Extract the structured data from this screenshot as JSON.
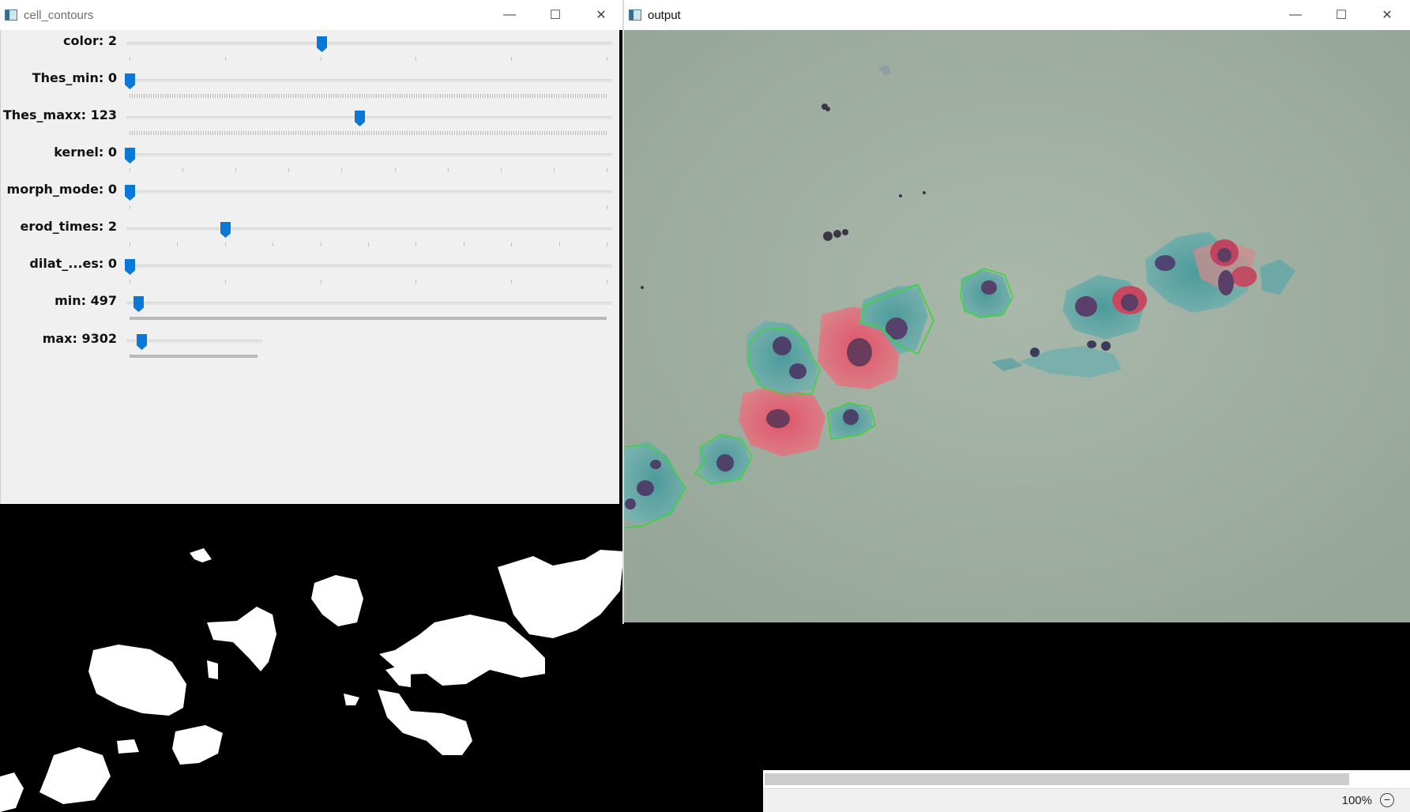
{
  "left_window": {
    "title": "cell_contours",
    "controls": {
      "minimize": "—",
      "maximize": "☐",
      "close": "✕"
    },
    "trackbars": [
      {
        "label": "color: 2",
        "fraction": 0.402,
        "ticks": "sparse"
      },
      {
        "label": "Thes_min: 0",
        "fraction": 0.0,
        "ticks": "dense"
      },
      {
        "label": "Thes_maxx: 123",
        "fraction": 0.482,
        "ticks": "dense"
      },
      {
        "label": "kernel: 0",
        "fraction": 0.0,
        "ticks": "sparse"
      },
      {
        "label": "morph_mode: 0",
        "fraction": 0.0,
        "ticks": "ends"
      },
      {
        "label": "erod_times: 2",
        "fraction": 0.2,
        "ticks": "sparse"
      },
      {
        "label": "dilat_...es: 0",
        "fraction": 0.0,
        "ticks": "sparse"
      },
      {
        "label": "min: 497",
        "fraction": 0.018,
        "ticks": "bar"
      },
      {
        "label": "max: 9302",
        "fraction": 0.093,
        "ticks": "bar-short"
      }
    ]
  },
  "right_window": {
    "title": "output",
    "controls": {
      "minimize": "—",
      "maximize": "☐",
      "close": "✕"
    }
  },
  "status_bar": {
    "zoom": "100%",
    "zoom_out": "−"
  },
  "colors": {
    "thumb": "#0a78d7",
    "contour": "#39d639",
    "background_slide": "#9fb0a2"
  }
}
